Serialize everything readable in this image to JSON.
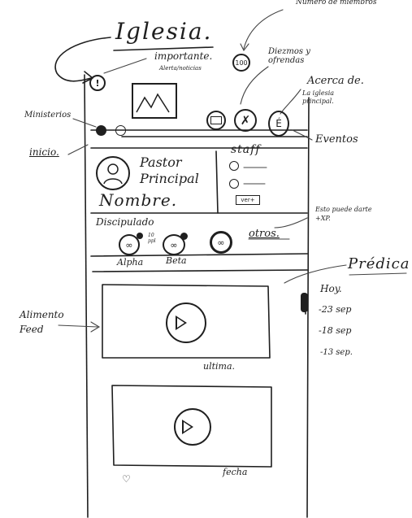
{
  "header": {
    "title": "Iglesia.",
    "importante_note": "importante.",
    "alert_note": "Alerta/noticias",
    "members_count": "100",
    "members_note": "Número de miembros"
  },
  "top_actions": {
    "donations_note": "Diezmos y ofrendas",
    "about_note": "Acerca de.",
    "about_sub": "La iglesia principal.",
    "events_label": "Eventos"
  },
  "side": {
    "ministries_label": "Ministerios",
    "home_label": "inicio."
  },
  "pastor": {
    "title": "Pastor Principal",
    "name": "Nombre."
  },
  "staff": {
    "label": "staff",
    "more_button": "ver+"
  },
  "discipleship": {
    "label": "Discipulado",
    "badge": "10 ppl",
    "items": [
      "Alpha",
      "Beta"
    ],
    "others_link": "otros.",
    "note": "Esto puede darte +XP."
  },
  "sermons": {
    "label": "Prédica",
    "dates": [
      "Hoy.",
      "-23 sep",
      "-18 sep",
      "-13 sep."
    ],
    "latest_label": "ultima.",
    "date_label": "fecha"
  },
  "feed": {
    "note": "Alimento Feed"
  }
}
